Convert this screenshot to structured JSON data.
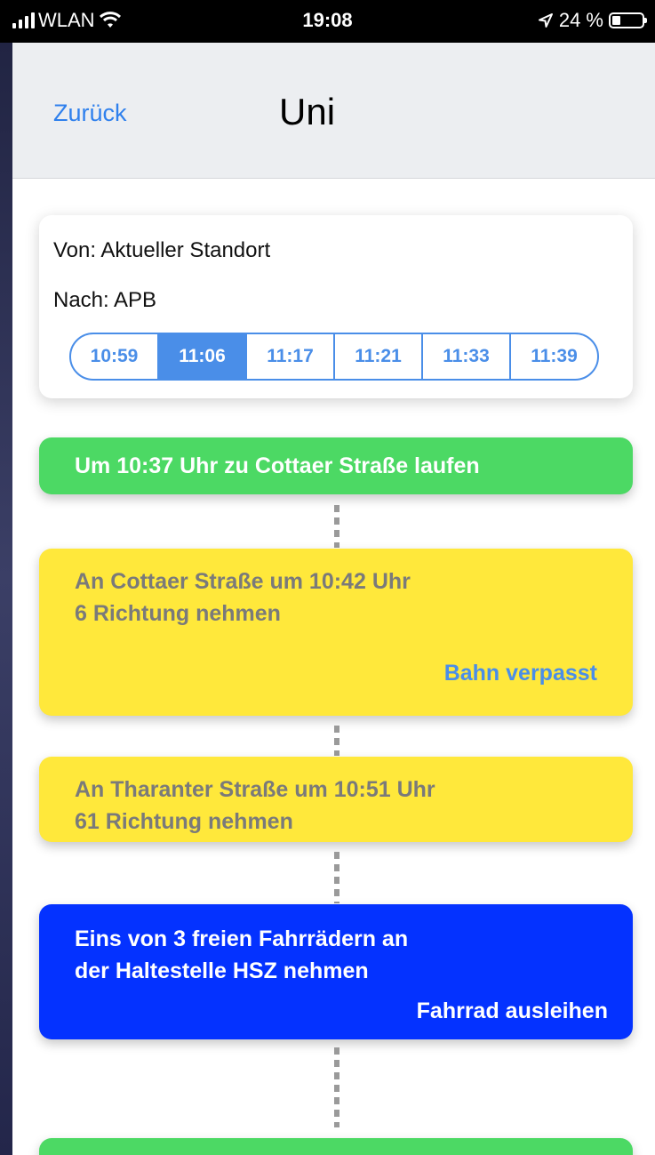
{
  "status_bar": {
    "carrier": "WLAN",
    "time": "19:08",
    "battery": "24 %"
  },
  "nav": {
    "back_label": "Zurück",
    "title": "Uni"
  },
  "route": {
    "from": "Von: Aktueller Standort",
    "to": "Nach: APB",
    "times": [
      "10:59",
      "11:06",
      "11:17",
      "11:21",
      "11:33",
      "11:39"
    ],
    "selected_time": "11:06"
  },
  "steps": [
    {
      "type": "walk",
      "color": "#4cd964",
      "lines": [
        "Um 10:37 Uhr zu Cottaer Straße laufen"
      ]
    },
    {
      "type": "transit",
      "color": "#ffe83b",
      "lines": [
        "An Cottaer Straße um 10:42 Uhr",
        "6 Richtung nehmen"
      ],
      "action": "Bahn verpasst"
    },
    {
      "type": "transit",
      "color": "#ffe83b",
      "lines": [
        "An Tharanter Straße um 10:51 Uhr",
        "61 Richtung nehmen"
      ]
    },
    {
      "type": "bike",
      "color": "#0432ff",
      "lines": [
        "Eins von 3 freien Fahrrädern an",
        "der Haltestelle HSZ nehmen"
      ],
      "action": "Fahrrad ausleihen"
    },
    {
      "type": "walk",
      "color": "#4cd964",
      "lines": []
    }
  ],
  "colors": {
    "accent": "#2f80ed",
    "segment": "#4a8ee8",
    "muted_text": "#7a7a7a",
    "bike_text": "#ffffff"
  }
}
